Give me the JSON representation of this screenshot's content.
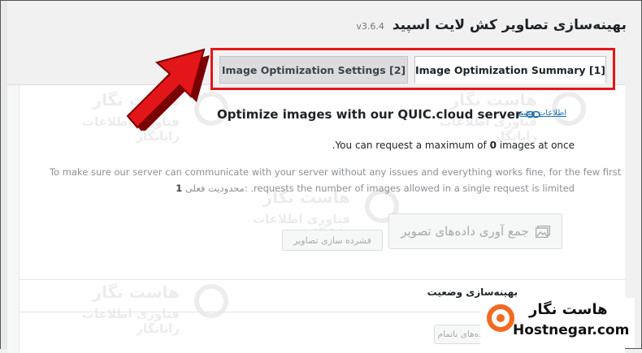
{
  "page": {
    "title": "بهینه‌سازی تصاویر کش لایت اسپید",
    "version": "v3.6.4"
  },
  "tabs": [
    {
      "label": "Image Optimization Settings [2]",
      "active": false
    },
    {
      "label": "Image Optimization Summary [1]",
      "active": true
    }
  ],
  "summary": {
    "learn_more": "اطلاعات بیشتر",
    "heading": "Optimize images with our QUIC.cloud server",
    "max_line_prefix": ".You can request a maximum of ",
    "max_value": "0",
    "max_line_suffix": " images at once",
    "note_line1": "To make sure our server can communicate with your server without any issues and everything works fine, for the few first",
    "note_line2_text": ".requests the number of images allowed in a single request is limited",
    "current_limit_label": "محدودیت فعلی:",
    "current_limit_value": "1",
    "gather_button": "جمع آوری داده‌های تصویر",
    "optimize_button": "فشرده سازی تصاویر"
  },
  "status": {
    "title": "بهینه‌سازی وضعیت",
    "incomplete_button": "داده‌های ناتمام"
  },
  "watermark": {
    "brand_fa": "هاست نگار",
    "tagline": "فناوری اطلاعات رایانگار"
  },
  "logo": {
    "brand_fa": "هاست نگار",
    "brand_en": "Hostnegar.com"
  },
  "colors": {
    "highlight_red": "#e3161a",
    "link_blue": "#2271b1",
    "brand_orange": "#f26a21"
  }
}
